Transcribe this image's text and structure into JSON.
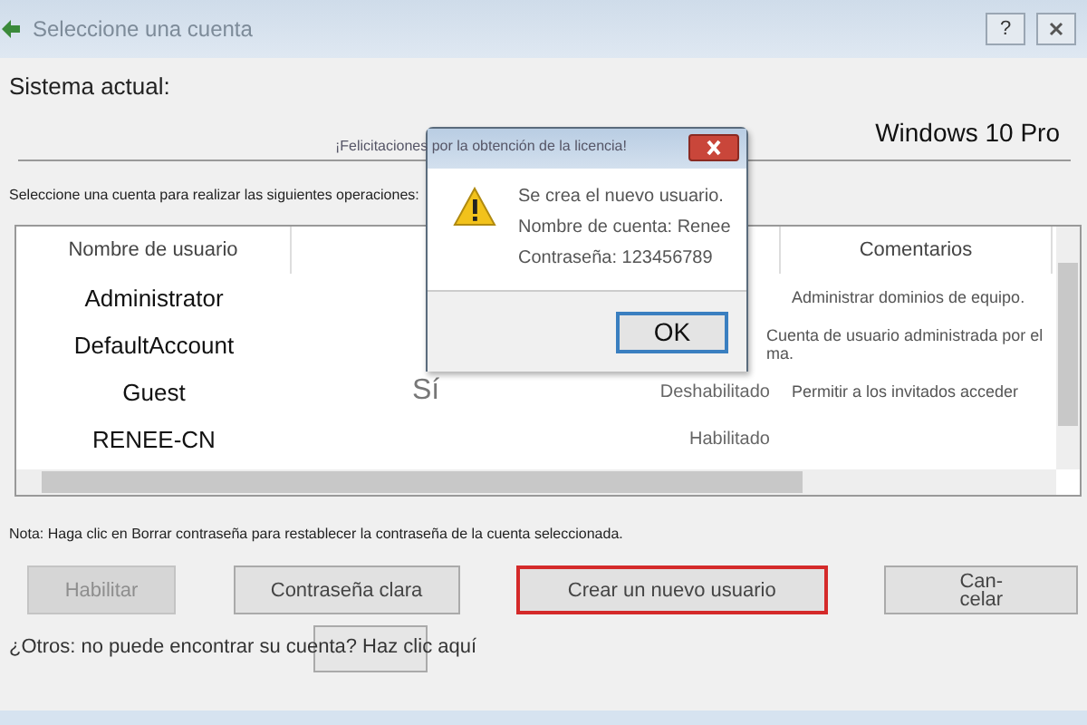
{
  "window": {
    "title": "Seleccione una cuenta",
    "help": "?"
  },
  "current_system": {
    "label": "Sistema actual:",
    "value": "Windows 10 Pro"
  },
  "instruction": "Seleccione una cuenta para realizar las siguientes operaciones:",
  "table": {
    "columns": [
      "Nombre de usuario",
      "Comentarios"
    ],
    "rows": [
      {
        "name": "Administrator",
        "comment": "Administrar dominios de equipo."
      },
      {
        "name": "DefaultAccount",
        "comment": "Cuenta de usuario administrada por el",
        "comment_2": "ma."
      },
      {
        "name": "Guest",
        "column_2": "Sí",
        "status": "Deshabilitado",
        "comment": "Permitir a los invitados acceder"
      },
      {
        "name": "RENEE-CN",
        "status": "Habilitado"
      }
    ]
  },
  "note": "Nota: Haga clic en Borrar contraseña para restablecer la contraseña de la cuenta seleccionada.",
  "buttons": [
    {
      "label": "Habilitar",
      "disabled": true,
      "focused": false
    },
    {
      "label": "Contraseña clara",
      "disabled": false,
      "focused": false
    },
    {
      "label": "Crear un nuevo usuario",
      "disabled": false,
      "focused": true
    },
    {
      "label": "Can-\ncelar",
      "disabled": false,
      "focused": false
    }
  ],
  "link": "¿Otros: no puede encontrar su cuenta? Haz clic aquí",
  "dialog": {
    "title": "¡Felicitaciones por la obtención de la licencia!",
    "lines": [
      "Se crea el nuevo usuario.",
      "Nombre de cuenta: Renee",
      "Contraseña: 123456789"
    ],
    "button": "OK"
  }
}
